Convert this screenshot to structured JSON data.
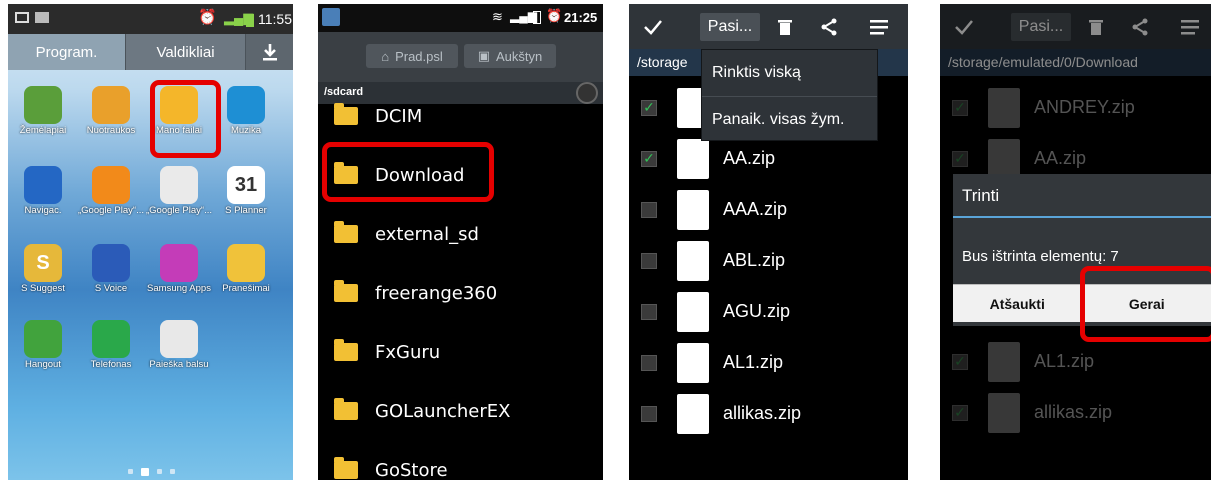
{
  "screen_home": {
    "time": "11:55",
    "tabs": [
      "Program.",
      "Valdikliai"
    ],
    "apps": [
      {
        "label": "Žemėlapiai",
        "icon": "maps-icon",
        "color": "#5a9e3a"
      },
      {
        "label": "Nuotraukos",
        "icon": "photos-icon",
        "color": "#e9a02b"
      },
      {
        "label": "Mano failai",
        "icon": "my-files-icon",
        "color": "#f4b62a"
      },
      {
        "label": "Muzika",
        "icon": "music-icon",
        "color": "#1e8fd4"
      },
      {
        "label": "Navigac.",
        "icon": "navigation-icon",
        "color": "#2467c4"
      },
      {
        "label": "„Google Play“...",
        "icon": "google-play-music-icon",
        "color": "#f28a1a"
      },
      {
        "label": "„Google Play“...",
        "icon": "google-play-store-icon",
        "color": "#eaeaea"
      },
      {
        "label": "S Planner",
        "icon": "calendar-icon",
        "color": "#ffffff",
        "badge": "31"
      },
      {
        "label": "S Suggest",
        "icon": "s-suggest-icon",
        "color": "#e6b83a",
        "badge": "S"
      },
      {
        "label": "S Voice",
        "icon": "microphone-icon",
        "color": "#2b5bb8"
      },
      {
        "label": "Samsung Apps",
        "icon": "samsung-apps-icon",
        "color": "#c43cb8"
      },
      {
        "label": "Pranešimai",
        "icon": "envelope-icon",
        "color": "#f0c23a"
      },
      {
        "label": "Hangout",
        "icon": "hangouts-icon",
        "color": "#41a33d"
      },
      {
        "label": "Telefonas",
        "icon": "phone-icon",
        "color": "#2aa84a"
      },
      {
        "label": "Paieška balsu",
        "icon": "voice-search-icon",
        "color": "#e8e8e8"
      }
    ]
  },
  "screen_files": {
    "time": "21:25",
    "home_btn": "Prad.psl",
    "up_btn": "Aukštyn",
    "path": "/sdcard",
    "folders": [
      "DCIM",
      "Download",
      "external_sd",
      "freerange360",
      "FxGuru",
      "GOLauncherEX",
      "GoStore"
    ]
  },
  "screen_select": {
    "dropdown_label": "Pasi...",
    "path": "/storage",
    "menu": [
      "Rinktis viską",
      "Panaik. visas žym."
    ],
    "files": [
      {
        "name": "ANDREY.zip",
        "checked": true
      },
      {
        "name": "AA.zip",
        "checked": true
      },
      {
        "name": "AAA.zip",
        "checked": false
      },
      {
        "name": "ABL.zip",
        "checked": false
      },
      {
        "name": "AGU.zip",
        "checked": false
      },
      {
        "name": "AL1.zip",
        "checked": false
      },
      {
        "name": "allikas.zip",
        "checked": false
      }
    ]
  },
  "screen_delete": {
    "dropdown_label": "Pasi...",
    "path": "/storage/emulated/0/Download",
    "files_visible": [
      "ANDREY.zip",
      "AA.zip",
      "AL1.zip",
      "allikas.zip"
    ],
    "dialog": {
      "title": "Trinti",
      "message": "Bus ištrinta elementų: 7",
      "cancel": "Atšaukti",
      "ok": "Gerai"
    }
  },
  "colors": {
    "highlight": "#e50000",
    "accent": "#5aa4d8",
    "check": "#34c159"
  }
}
